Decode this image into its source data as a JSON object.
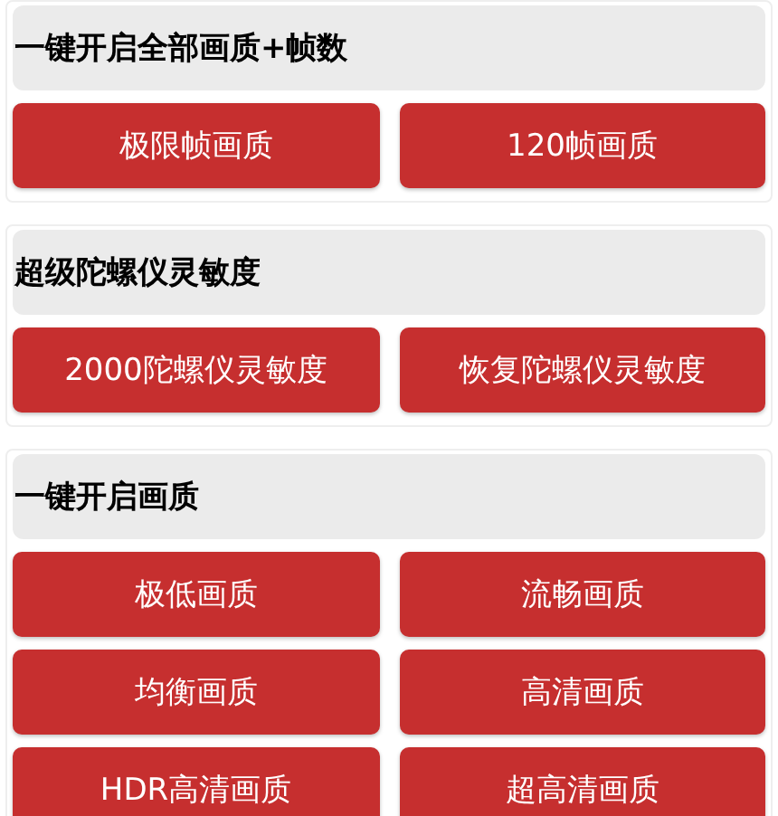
{
  "sections": [
    {
      "title": "一键开启全部画质+帧数",
      "buttons": [
        "极限帧画质",
        "120帧画质"
      ]
    },
    {
      "title": "超级陀螺仪灵敏度",
      "buttons": [
        "2000陀螺仪灵敏度",
        "恢复陀螺仪灵敏度"
      ]
    },
    {
      "title": "一键开启画质",
      "buttons": [
        "极低画质",
        "流畅画质",
        "均衡画质",
        "高清画质",
        "HDR高清画质",
        "超高清画质"
      ]
    }
  ]
}
